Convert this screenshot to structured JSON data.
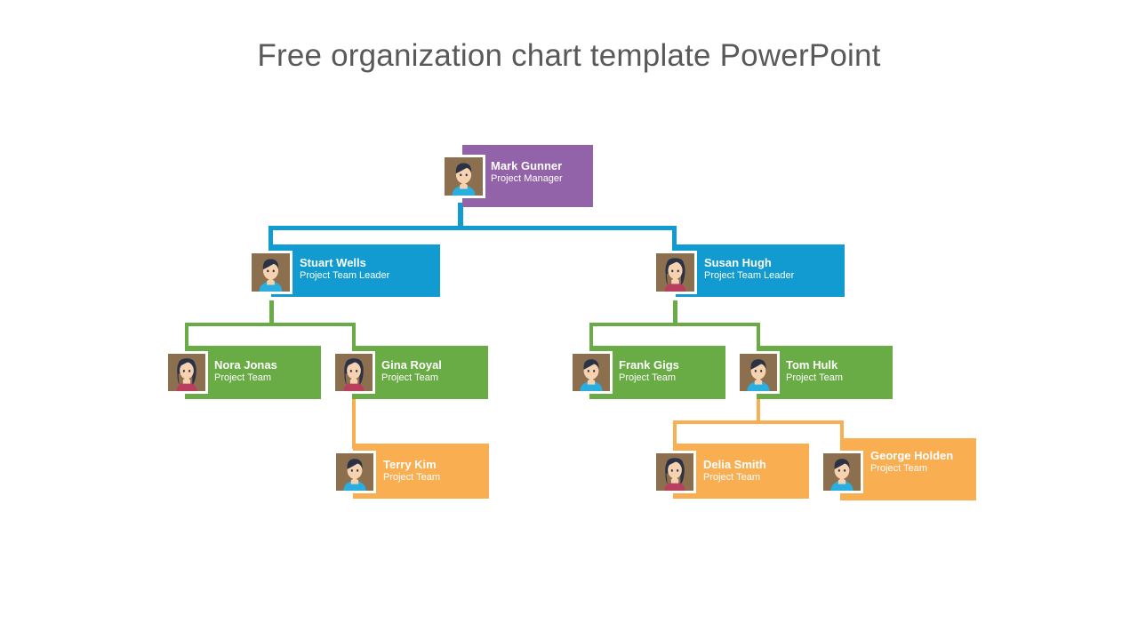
{
  "page": {
    "title": "Free organization chart template PowerPoint"
  },
  "colors": {
    "purple": "#9263A9",
    "blue": "#119BD1",
    "green": "#69AB45",
    "orange": "#F8AE51",
    "title_text": "#595959",
    "node_text": "#ffffff",
    "avatar_bg": "#8B6F4E",
    "avatar_hair": "#2B3245",
    "avatar_skin": "#F7D2B0",
    "avatar_shirt_male": "#2AAEE0",
    "avatar_shirt_female": "#B8405E",
    "background": "#ffffff"
  },
  "chart_data": {
    "type": "diagram",
    "title": "Free organization chart template PowerPoint",
    "levels": 4,
    "nodes": [
      {
        "id": "mark-gunner",
        "name": "Mark Gunner",
        "role": "Project Manager",
        "level": 1,
        "color": "#9263A9",
        "avatar": "male",
        "parent": null
      },
      {
        "id": "stuart-wells",
        "name": "Stuart Wells",
        "role": "Project Team Leader",
        "level": 2,
        "color": "#119BD1",
        "avatar": "male",
        "parent": "mark-gunner"
      },
      {
        "id": "susan-hugh",
        "name": "Susan Hugh",
        "role": "Project Team Leader",
        "level": 2,
        "color": "#119BD1",
        "avatar": "female",
        "parent": "mark-gunner"
      },
      {
        "id": "nora-jonas",
        "name": "Nora Jonas",
        "role": "Project Team",
        "level": 3,
        "color": "#69AB45",
        "avatar": "female",
        "parent": "stuart-wells"
      },
      {
        "id": "gina-royal",
        "name": "Gina Royal",
        "role": "Project Team",
        "level": 3,
        "color": "#69AB45",
        "avatar": "female",
        "parent": "stuart-wells"
      },
      {
        "id": "frank-gigs",
        "name": "Frank Gigs",
        "role": "Project Team",
        "level": 3,
        "color": "#69AB45",
        "avatar": "male",
        "parent": "susan-hugh"
      },
      {
        "id": "tom-hulk",
        "name": "Tom Hulk",
        "role": "Project Team",
        "level": 3,
        "color": "#69AB45",
        "avatar": "male",
        "parent": "susan-hugh"
      },
      {
        "id": "terry-kim",
        "name": "Terry Kim",
        "role": "Project Team",
        "level": 4,
        "color": "#F8AE51",
        "avatar": "male",
        "parent": "gina-royal"
      },
      {
        "id": "delia-smith",
        "name": "Delia Smith",
        "role": "Project Team",
        "level": 4,
        "color": "#F8AE51",
        "avatar": "female",
        "parent": "tom-hulk"
      },
      {
        "id": "george-holden",
        "name": "George Holden",
        "role": "Project Team",
        "level": 4,
        "color": "#F8AE51",
        "avatar": "male",
        "parent": "tom-hulk"
      }
    ]
  }
}
